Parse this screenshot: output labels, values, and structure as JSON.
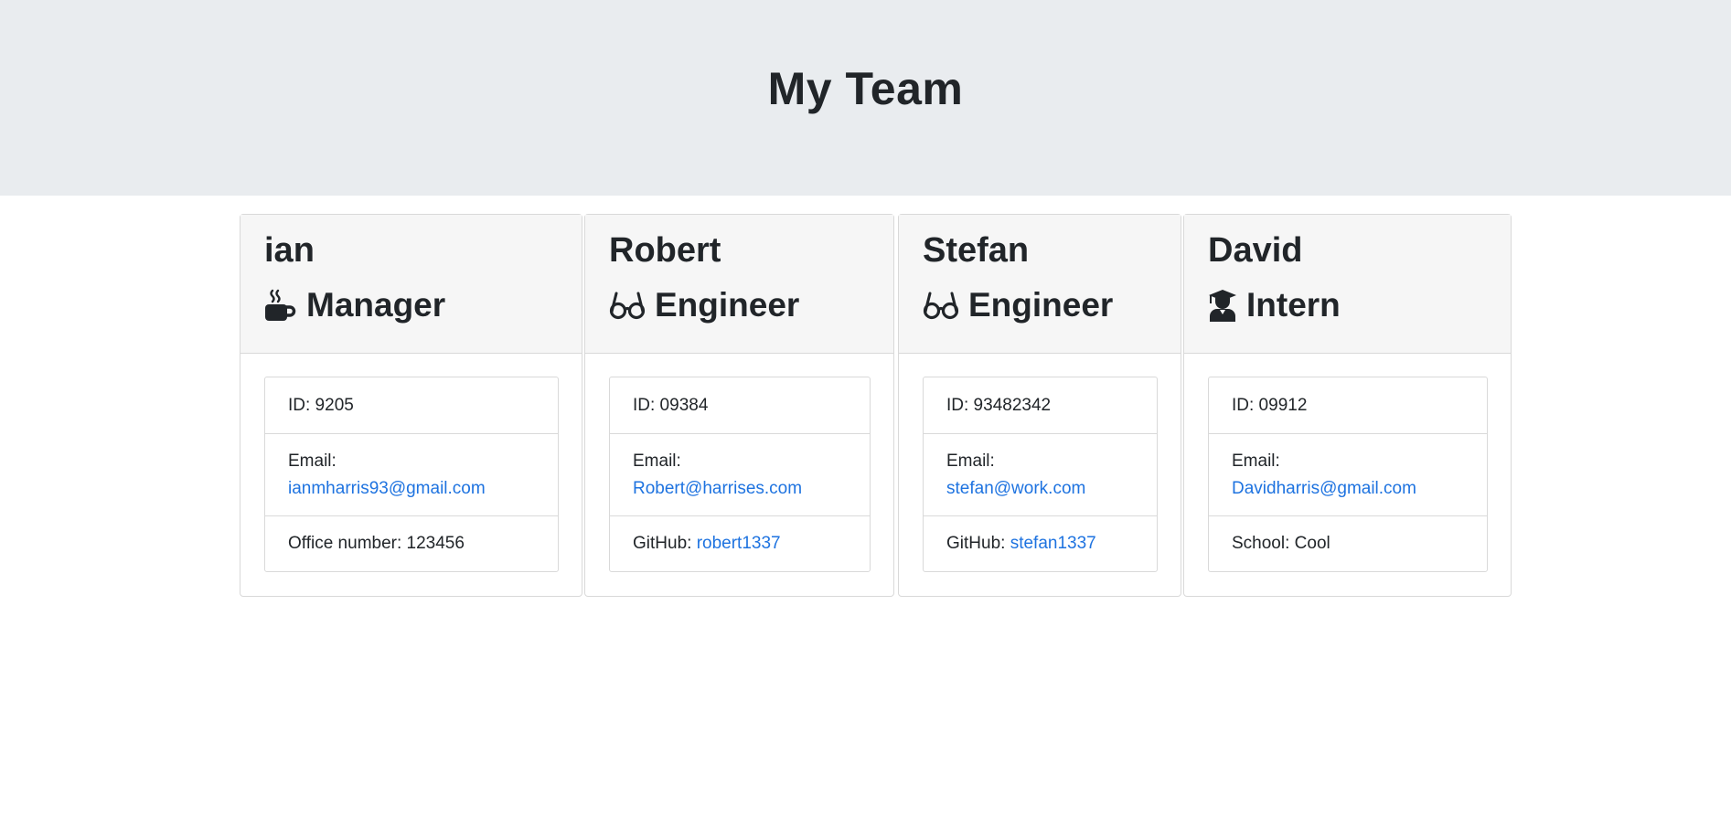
{
  "header": {
    "title": "My Team"
  },
  "cards": [
    {
      "name": "ian",
      "role": "Manager",
      "icon": "coffee-icon",
      "id_text": "ID: 9205",
      "email_label": "Email:",
      "email": "ianmharris93@gmail.com",
      "extra_label": "Office number: 123456",
      "extra_link": ""
    },
    {
      "name": "Robert",
      "role": "Engineer",
      "icon": "glasses-icon",
      "id_text": "ID: 09384",
      "email_label": "Email:",
      "email": "Robert@harrises.com",
      "extra_label": "GitHub: ",
      "extra_link": "robert1337"
    },
    {
      "name": "Stefan",
      "role": "Engineer",
      "icon": "glasses-icon",
      "id_text": "ID: 93482342",
      "email_label": "Email:",
      "email": "stefan@work.com",
      "extra_label": "GitHub: ",
      "extra_link": "stefan1337"
    },
    {
      "name": "David",
      "role": "Intern",
      "icon": "graduate-icon",
      "id_text": "ID: 09912",
      "email_label": "Email:",
      "email": "Davidharris@gmail.com",
      "extra_label": "School: Cool",
      "extra_link": ""
    }
  ],
  "colors": {
    "link": "#1e73e0",
    "header_bg": "#e9ecef",
    "card_header_bg": "#f6f6f6",
    "text": "#212529"
  }
}
